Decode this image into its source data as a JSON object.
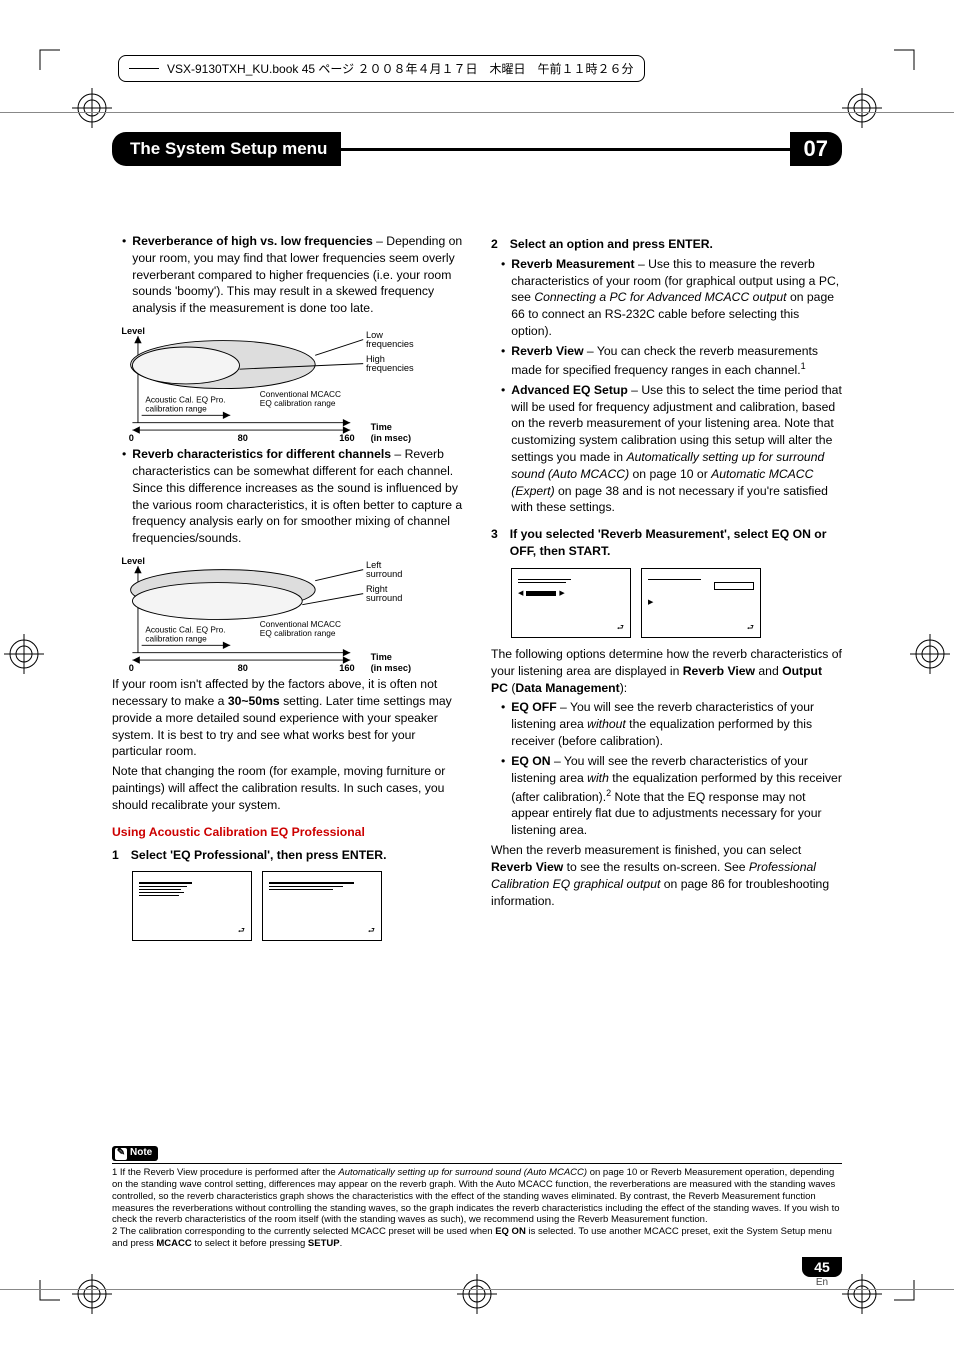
{
  "bookinfo": "VSX-9130TXH_KU.book  45 ページ  ２００８年４月１７日　木曜日　午前１１時２６分",
  "header": {
    "title": "The System Setup menu",
    "chapter": "07"
  },
  "col1": {
    "b1_title": "Reverberance of high vs. low frequencies",
    "b1_body": " – Depending on your room, you may find that lower frequencies seem overly reverberant compared to higher frequencies (i.e. your room sounds 'boomy'). This may result in a skewed frequency analysis if the measurement is done too late.",
    "b2_title": "Reverb characteristics for different channels",
    "b2_body": " – Reverb characteristics can be somewhat different for each channel. Since this difference increases as the sound is influenced by the various room characteristics, it is often better to capture a frequency analysis early on for smoother mixing of channel frequencies/sounds.",
    "p1a": "If your room isn't affected by the factors above, it is often not necessary to make a ",
    "p1b": "30~50ms",
    "p1c": " setting. Later time settings may provide a more detailed sound experience with your speaker system. It is best to try and see what works best for your particular room.",
    "p2": "Note that changing the room (for example, moving furniture or paintings) will affect the calibration results. In such cases, you should recalibrate your system.",
    "h_red": "Using Acoustic Calibration EQ Professional",
    "step1": "Select 'EQ Professional', then press ENTER."
  },
  "col2": {
    "step2": "Select an option and press ENTER.",
    "b1_title": "Reverb Measurement",
    "b1_body1": " – Use this to measure the reverb characteristics of your room (for graphical output using a PC, see ",
    "b1_it": "Connecting a PC for Advanced MCACC output",
    "b1_body2": " on page 66 to connect an RS-232C cable before selecting this option).",
    "b2_title": "Reverb View",
    "b2_body": " – You can check the reverb measurements made for specified frequency ranges in each channel.",
    "b2_sup": "1",
    "b3_title": "Advanced EQ Setup",
    "b3_body1": " – Use this to select the time period that will be used for frequency adjustment and calibration, based on the reverb measurement of your listening area. Note that customizing system calibration using this setup will alter the settings you made in ",
    "b3_it1": "Automatically setting up for surround sound (Auto MCACC)",
    "b3_body2": " on page 10 or ",
    "b3_it2": "Automatic MCACC (Expert)",
    "b3_body3": " on page 38 and is not necessary if you're satisfied with these settings.",
    "step3": "If you selected 'Reverb Measurement', select EQ ON or OFF, then START.",
    "p1a": "The following options determine how the reverb characteristics of your listening area are displayed in ",
    "p1b": "Reverb View",
    "p1c": " and ",
    "p1d": "Output PC",
    "p1e": " (",
    "p1f": "Data Management",
    "p1g": "):",
    "b4_title": "EQ OFF",
    "b4_body1": " – You will see the reverb characteristics of your listening area ",
    "b4_it": "without",
    "b4_body2": " the equalization performed by this receiver (before calibration).",
    "b5_title": "EQ ON",
    "b5_body1": " – You will see the reverb characteristics of your listening area ",
    "b5_it": "with",
    "b5_body2": " the equalization performed by this receiver (after calibration).",
    "b5_sup": "2",
    "b5_body3": " Note that the EQ response may not appear entirely flat due to adjustments necessary for your listening area.",
    "p2a": "When the reverb measurement is finished, you can select ",
    "p2b": "Reverb View",
    "p2c": " to see the results on-screen. See ",
    "p2d": "Professional Calibration EQ graphical output",
    "p2e": " on page 86 for troubleshooting information."
  },
  "note": {
    "label": "Note",
    "n1a": "1 If the Reverb View procedure is performed after the ",
    "n1it": "Automatically setting up for surround sound (Auto MCACC)",
    "n1b": " on page 10 or Reverb Measurement operation, depending on the standing wave control setting, differences may appear on the reverb graph. With the Auto MCACC function, the reverberations are measured with the standing waves controlled, so the reverb characteristics graph shows the characteristics with the effect of the standing waves eliminated. By contrast, the Reverb Measurement function measures the reverberations without controlling the standing waves, so the graph indicates the reverb characteristics including the effect of the standing waves. If you wish to check the reverb characteristics of the room itself (with the standing waves as such), we recommend using the Reverb Measurement function.",
    "n2a": "2 The calibration corresponding to the currently selected MCACC preset will be used when ",
    "n2b": "EQ ON",
    "n2c": " is selected. To use another MCACC preset, exit the System Setup menu and press ",
    "n2d": "MCACC",
    "n2e": " to select it before pressing ",
    "n2f": "SETUP",
    "n2g": "."
  },
  "page": {
    "num": "45",
    "lang": "En"
  },
  "chart_data": [
    {
      "type": "line",
      "title": "",
      "xlabel": "Time (in msec)",
      "ylabel": "Level",
      "x_ticks": [
        0,
        80,
        160
      ],
      "series": [
        {
          "name": "Low frequencies",
          "shape": "ellipse-wide"
        },
        {
          "name": "High frequencies",
          "shape": "ellipse-narrow"
        }
      ],
      "annotations": [
        "Acoustic Cal. EQ Pro. calibration range",
        "Conventional MCACC EQ calibration range"
      ]
    },
    {
      "type": "line",
      "title": "",
      "xlabel": "Time (in msec)",
      "ylabel": "Level",
      "x_ticks": [
        0,
        80,
        160
      ],
      "series": [
        {
          "name": "Left surround",
          "shape": "ellipse-top"
        },
        {
          "name": "Right surround",
          "shape": "ellipse-bottom"
        }
      ],
      "annotations": [
        "Acoustic Cal. EQ Pro. calibration range",
        "Conventional MCACC EQ calibration range"
      ]
    }
  ],
  "chart_labels": {
    "level": "Level",
    "time": "Time",
    "inmsec": "(in msec)",
    "t0": "0",
    "t80": "80",
    "t160": "160",
    "lowf": "Low frequencies",
    "highf": "High frequencies",
    "left": "Left surround",
    "right": "Right surround",
    "aceq": "Acoustic Cal. EQ Pro. calibration range",
    "conv": "Conventional MCACC EQ calibration range"
  }
}
